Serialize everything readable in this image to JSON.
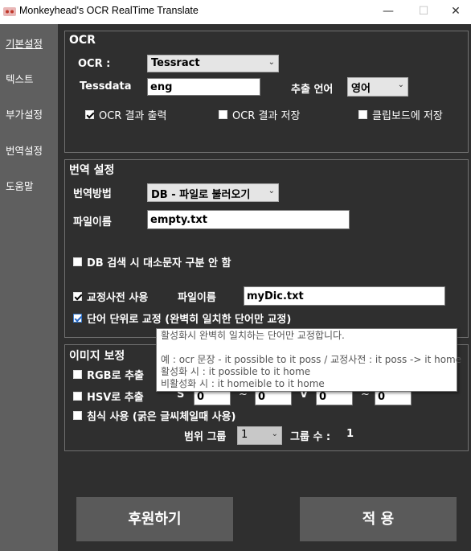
{
  "window": {
    "title": "Monkeyhead's OCR RealTime Translate",
    "minimize_glyph": "—",
    "maximize_glyph": "☐",
    "close_glyph": "✕"
  },
  "sidebar": {
    "items": [
      {
        "label": "기본설정",
        "active": true
      },
      {
        "label": "텍스트",
        "active": false
      },
      {
        "label": "부가설정",
        "active": false
      },
      {
        "label": "번역설정",
        "active": false
      },
      {
        "label": "도움말",
        "active": false
      }
    ]
  },
  "ocr": {
    "title": "OCR",
    "ocr_label": "OCR :",
    "ocr_engine": "Tessract",
    "tessdata_label": "Tessdata",
    "tessdata_value": "eng",
    "extract_lang_label": "추출 언어",
    "extract_lang_value": "영어",
    "print_result": {
      "label": "OCR 결과 출력",
      "checked": true
    },
    "save_result": {
      "label": "OCR 결과 저장",
      "checked": false
    },
    "clipboard_save": {
      "label": "클립보드에 저장",
      "checked": false
    }
  },
  "translate": {
    "title": "번역 설정",
    "method_label": "번역방법",
    "method_value": "DB - 파일로 불러오기",
    "filename_label": "파일이름",
    "filename_value": "empty.txt",
    "case_insensitive": {
      "label": "DB 검색 시 대소문자 구분 안 함",
      "checked": false
    },
    "use_dict": {
      "label": "교정사전 사용",
      "checked": true
    },
    "dict_filename_label": "파일이름",
    "dict_filename_value": "myDic.txt",
    "word_correction": {
      "label": "단어 단위로 교정 (완벽히 일치한 단어만 교정)",
      "checked": true
    }
  },
  "tooltip": {
    "lines": [
      "활성화시 완벽히 일치하는 단어만 교정합니다.",
      "",
      "예 : ocr 문장 - it possible to it poss  / 교정사전 : it poss -> it home",
      "활성화 시 : it possible to it home",
      "비활성화 시 : it homeible to it home"
    ]
  },
  "image": {
    "title": "이미지 보정",
    "rgb_label": "RGB로 추출",
    "hsv_label": "HSV로 추출",
    "s_label": "S",
    "v_label": "V",
    "tilde": "~",
    "hsv_s_min": "0",
    "hsv_s_max": "0",
    "hsv_v_min": "0",
    "hsv_v_max": "0",
    "erosion": {
      "label": "침식 사용 (굵은 글씨체일때 사용)",
      "checked": false
    },
    "range_group_label": "범위 그룹",
    "range_group_value": "1",
    "group_count_label": "그룹 수 :",
    "group_count_value": "1"
  },
  "buttons": {
    "donate": "후원하기",
    "apply": "적 용"
  }
}
